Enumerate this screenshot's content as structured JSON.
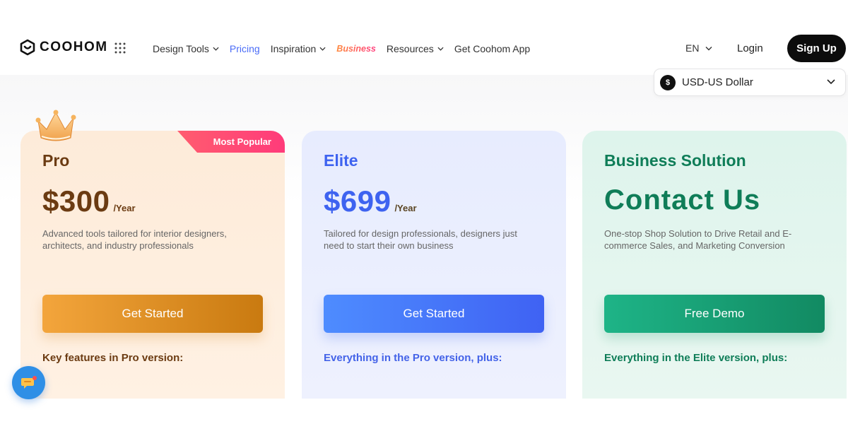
{
  "brand": {
    "name": "COOHOM"
  },
  "nav": {
    "items": [
      {
        "label": "Design Tools",
        "has_dropdown": true
      },
      {
        "label": "Pricing",
        "active": true
      },
      {
        "label": "Inspiration",
        "has_dropdown": true
      },
      {
        "label": "Business",
        "style": "gradient-italic"
      },
      {
        "label": "Resources",
        "has_dropdown": true
      },
      {
        "label": "Get Coohom App"
      }
    ]
  },
  "header_right": {
    "language": "EN",
    "login": "Login",
    "signup": "Sign Up"
  },
  "currency": {
    "symbol": "$",
    "label": "USD-US Dollar"
  },
  "plans": [
    {
      "name": "Pro",
      "badge": "Most Popular",
      "price": "$300",
      "period": "/Year",
      "description": "Advanced tools tailored for interior designers, architects, and industry professionals",
      "cta": "Get Started",
      "features_heading": "Key features in Pro version:"
    },
    {
      "name": "Elite",
      "price": "$699",
      "period": "/Year",
      "description": "Tailored for design professionals, designers just need to start their own business",
      "cta": "Get Started",
      "features_heading": "Everything in the Pro version, plus:"
    },
    {
      "name": "Business Solution",
      "headline": "Contact Us",
      "description": "One-stop Shop Solution to Drive Retail and E-commerce Sales, and Marketing Conversion",
      "cta": "Free Demo",
      "features_heading": "Everything in the Elite version, plus:"
    }
  ],
  "colors": {
    "pro": "#6b3b12",
    "elite": "#3e63f0",
    "business": "#0f7d58",
    "signup_bg": "#0c0c0c"
  }
}
